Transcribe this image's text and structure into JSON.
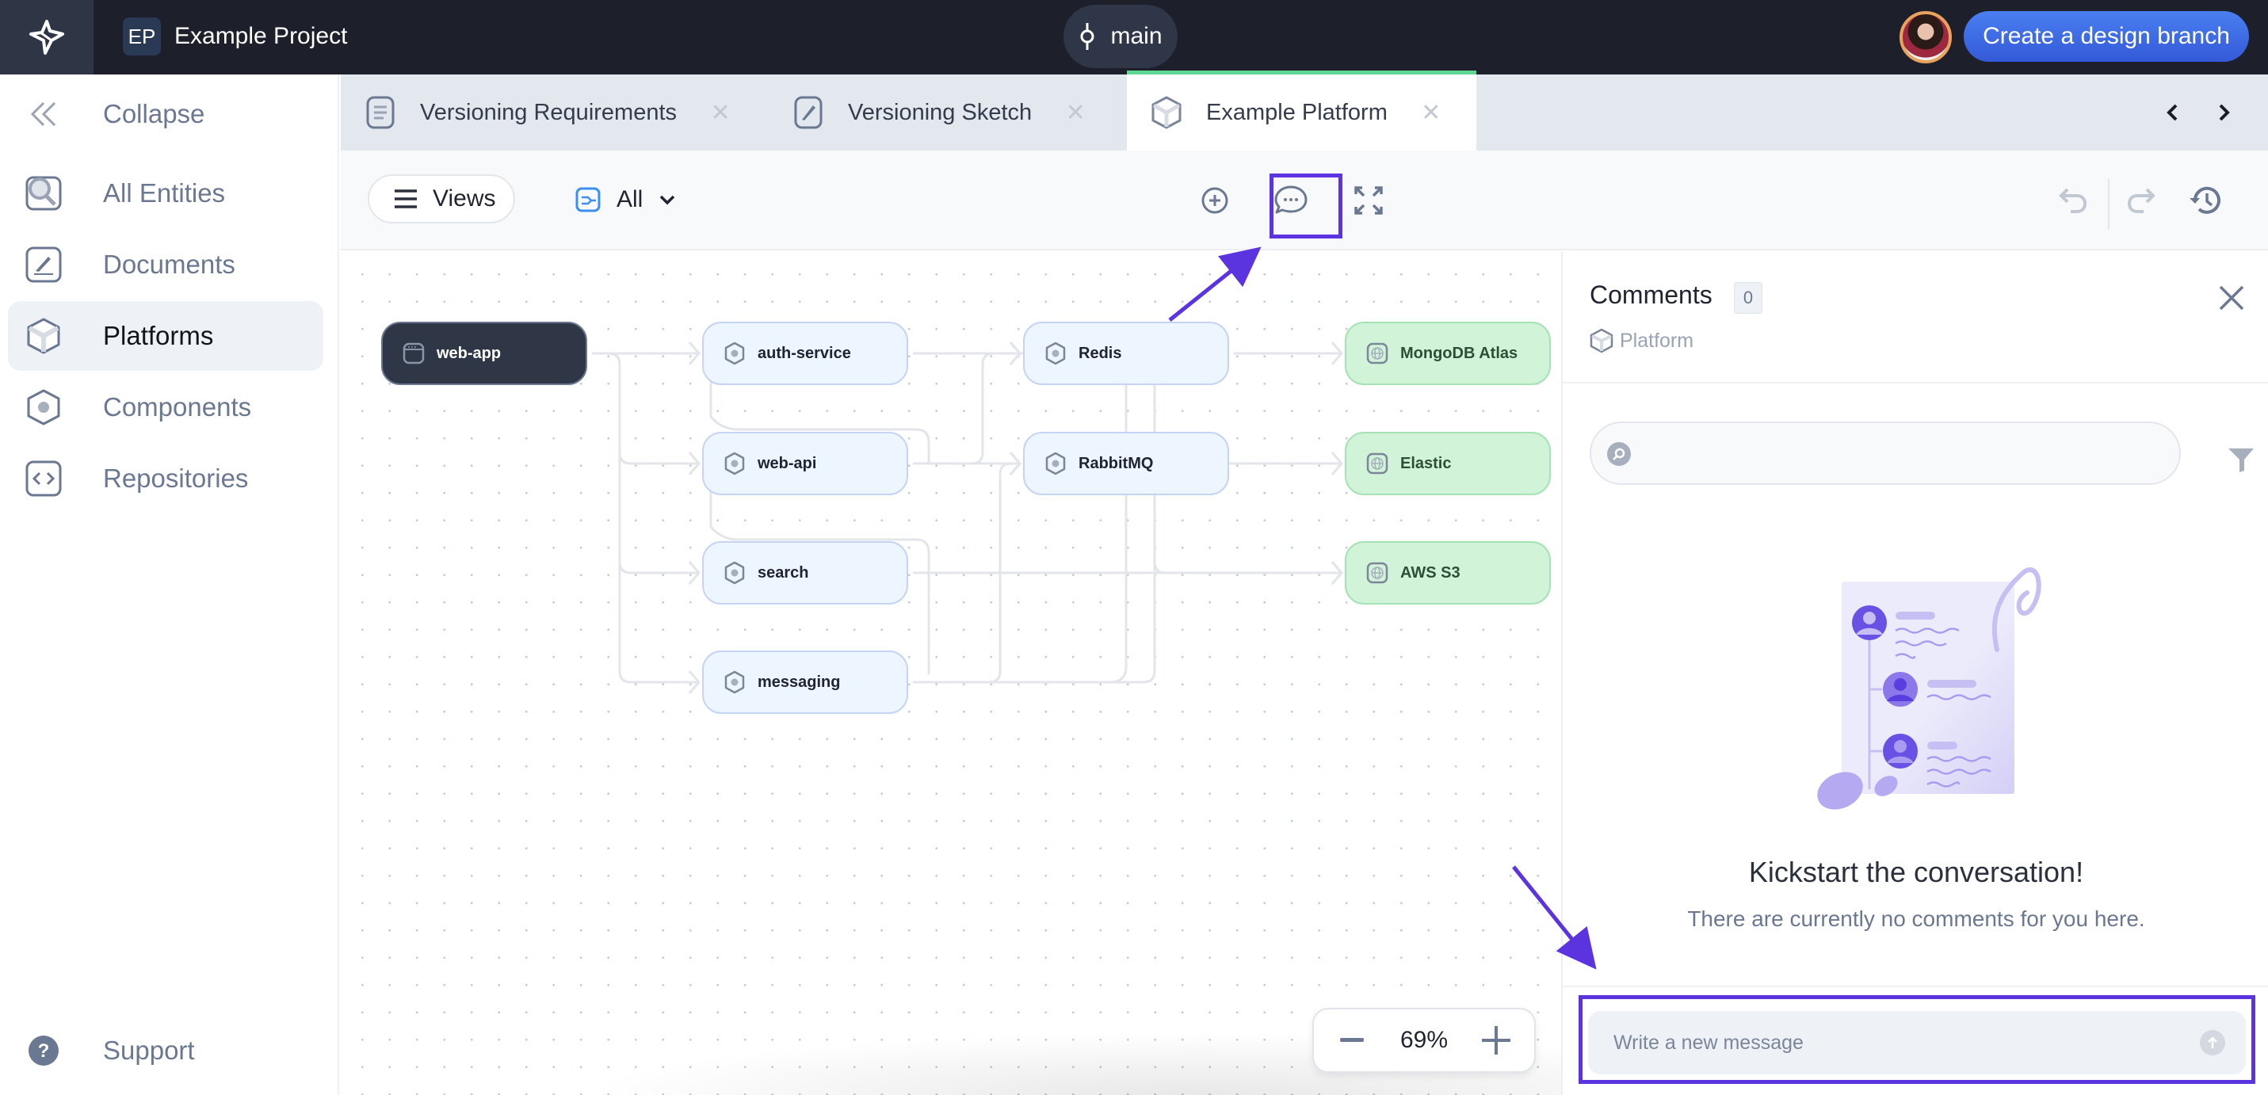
{
  "topbar": {
    "logo": "star-logo",
    "project_initials": "EP",
    "project_name": "Example Project",
    "branch": "main",
    "create_branch_label": "Create a design branch"
  },
  "sidebar": {
    "collapse_label": "Collapse",
    "items": [
      {
        "label": "All Entities",
        "icon": "search-square-icon",
        "active": false
      },
      {
        "label": "Documents",
        "icon": "document-pen-icon",
        "active": false
      },
      {
        "label": "Platforms",
        "icon": "cube-icon",
        "active": true
      },
      {
        "label": "Components",
        "icon": "hexagon-dot-icon",
        "active": false
      },
      {
        "label": "Repositories",
        "icon": "code-brackets-icon",
        "active": false
      }
    ],
    "support_label": "Support"
  },
  "tabs": [
    {
      "label": "Versioning Requirements",
      "icon": "document-lines-icon",
      "active": false
    },
    {
      "label": "Versioning Sketch",
      "icon": "sketch-icon",
      "active": false
    },
    {
      "label": "Example Platform",
      "icon": "cube-icon",
      "active": true
    }
  ],
  "toolbar": {
    "views_label": "Views",
    "filter_value": "All"
  },
  "diagram": {
    "nodes": [
      {
        "id": "web-app",
        "label": "web-app",
        "type": "app"
      },
      {
        "id": "auth-service",
        "label": "auth-service",
        "type": "component"
      },
      {
        "id": "web-api",
        "label": "web-api",
        "type": "component"
      },
      {
        "id": "search",
        "label": "search",
        "type": "component"
      },
      {
        "id": "messaging",
        "label": "messaging",
        "type": "component"
      },
      {
        "id": "redis",
        "label": "Redis",
        "type": "component"
      },
      {
        "id": "rabbitmq",
        "label": "RabbitMQ",
        "type": "component"
      },
      {
        "id": "mongodb",
        "label": "MongoDB Atlas",
        "type": "external"
      },
      {
        "id": "elastic",
        "label": "Elastic",
        "type": "external"
      },
      {
        "id": "aws-s3",
        "label": "AWS S3",
        "type": "external"
      }
    ],
    "zoom_level": "69%"
  },
  "comments": {
    "title": "Comments",
    "count": "0",
    "context_label": "Platform",
    "search_placeholder": "",
    "empty_title": "Kickstart the conversation!",
    "empty_subtitle": "There are currently no comments for you here.",
    "message_placeholder": "Write a new message"
  },
  "colors": {
    "accent": "#3f6ce6",
    "annotation": "#5b34e0",
    "active_tab_indicator": "#5fd694"
  }
}
